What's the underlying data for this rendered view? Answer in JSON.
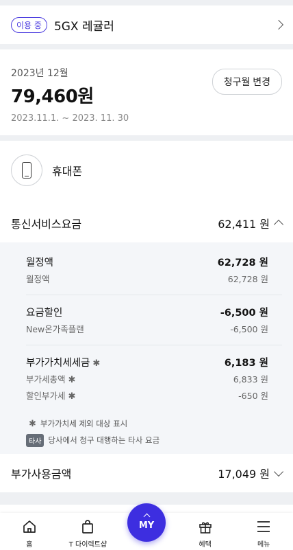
{
  "plan": {
    "badge": "이용 중",
    "name": "5GX 레귤러"
  },
  "bill": {
    "month": "2023년 12월",
    "total": "79,460원",
    "period": "2023.11.1. ~ 2023. 11. 30",
    "change_button": "청구월 변경"
  },
  "device": {
    "label": "휴대폰"
  },
  "telecom": {
    "title": "통신서비스요금",
    "amount": "62,411 원",
    "groups": [
      {
        "label": "월정액",
        "value": "62,728 원",
        "subs": [
          {
            "label": "월정액",
            "value": "62,728 원"
          }
        ]
      },
      {
        "label": "요금할인",
        "value": "-6,500 원",
        "subs": [
          {
            "label": "New온가족플랜",
            "value": "-6,500 원"
          }
        ]
      },
      {
        "label": "부가가치세세금",
        "value": "6,183 원",
        "subs": [
          {
            "label": "부가세총액",
            "value": "6,833 원"
          },
          {
            "label": "할인부가세",
            "value": "-650 원"
          }
        ]
      }
    ],
    "star": "✱",
    "note_vat": "부가가치세 제외 대상 표시",
    "note_tag": "타사",
    "note_other": "당사에서 청구 대행하는 타사 요금"
  },
  "extra": {
    "title": "부가사용금액",
    "amount": "17,049 원"
  },
  "nav": {
    "home": "홈",
    "shop": "T 다이렉트샵",
    "my": "MY",
    "benefit": "혜택",
    "menu": "메뉴"
  }
}
